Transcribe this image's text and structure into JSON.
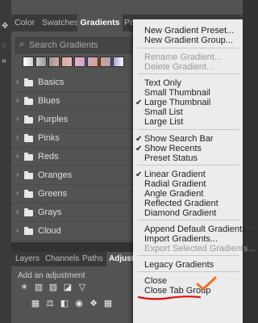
{
  "toolbar_icons": [
    "move-icon",
    "lasso-icon",
    "crop-icon"
  ],
  "tabs": [
    {
      "label": "Color",
      "active": false
    },
    {
      "label": "Swatches",
      "active": false
    },
    {
      "label": "Gradients",
      "active": true
    },
    {
      "label": "Patterns",
      "active": false
    }
  ],
  "search": {
    "placeholder": "Search Gradients"
  },
  "recent_gradient_colors": [
    "#ffffff",
    "#cfcfcf",
    "#9a9a9a",
    "#d9a9a0",
    "#e6b7bd",
    "#c8a8d6",
    "#e0a072",
    "#a8a0d8"
  ],
  "groups": [
    {
      "label": "Basics"
    },
    {
      "label": "Blues"
    },
    {
      "label": "Purples"
    },
    {
      "label": "Pinks"
    },
    {
      "label": "Reds"
    },
    {
      "label": "Oranges"
    },
    {
      "label": "Greens"
    },
    {
      "label": "Grays"
    },
    {
      "label": "Cloud"
    }
  ],
  "bottom_tabs": [
    {
      "label": "Layers",
      "active": false
    },
    {
      "label": "Channels",
      "active": false
    },
    {
      "label": "Paths",
      "active": false
    },
    {
      "label": "Adjustm",
      "active": true
    }
  ],
  "adjustments": {
    "title": "Add an adjustment"
  },
  "menu": {
    "items": [
      {
        "label": "New Gradient Preset...",
        "disabled": false,
        "checked": false
      },
      {
        "label": "New Gradient Group...",
        "disabled": false,
        "checked": false
      },
      {
        "label": "Rename Gradient...",
        "disabled": true,
        "checked": false
      },
      {
        "label": "Delete Gradient...",
        "disabled": true,
        "checked": false
      },
      {
        "label": "Text Only",
        "disabled": false,
        "checked": false
      },
      {
        "label": "Small Thumbnail",
        "disabled": false,
        "checked": false
      },
      {
        "label": "Large Thumbnail",
        "disabled": false,
        "checked": true
      },
      {
        "label": "Small List",
        "disabled": false,
        "checked": false
      },
      {
        "label": "Large List",
        "disabled": false,
        "checked": false
      },
      {
        "label": "Show Search Bar",
        "disabled": false,
        "checked": true
      },
      {
        "label": "Show Recents",
        "disabled": false,
        "checked": true
      },
      {
        "label": "Preset Status",
        "disabled": false,
        "checked": false
      },
      {
        "label": "Linear Gradient",
        "disabled": false,
        "checked": true
      },
      {
        "label": "Radial Gradient",
        "disabled": false,
        "checked": false
      },
      {
        "label": "Angle Gradient",
        "disabled": false,
        "checked": false
      },
      {
        "label": "Reflected Gradient",
        "disabled": false,
        "checked": false
      },
      {
        "label": "Diamond Gradient",
        "disabled": false,
        "checked": false
      },
      {
        "label": "Append Default Gradients...",
        "disabled": false,
        "checked": false
      },
      {
        "label": "Import Gradients...",
        "disabled": false,
        "checked": false
      },
      {
        "label": "Export Selected Gradients...",
        "disabled": true,
        "checked": false
      },
      {
        "label": "Legacy Gradients",
        "disabled": false,
        "checked": false
      },
      {
        "label": "Close",
        "disabled": false,
        "checked": false
      },
      {
        "label": "Close Tab Group",
        "disabled": false,
        "checked": false
      }
    ]
  },
  "colors": {
    "panel_bg": "#535353",
    "menu_bg": "#ececec",
    "annotation_red": "#e01010",
    "annotation_orange": "#f07020"
  }
}
